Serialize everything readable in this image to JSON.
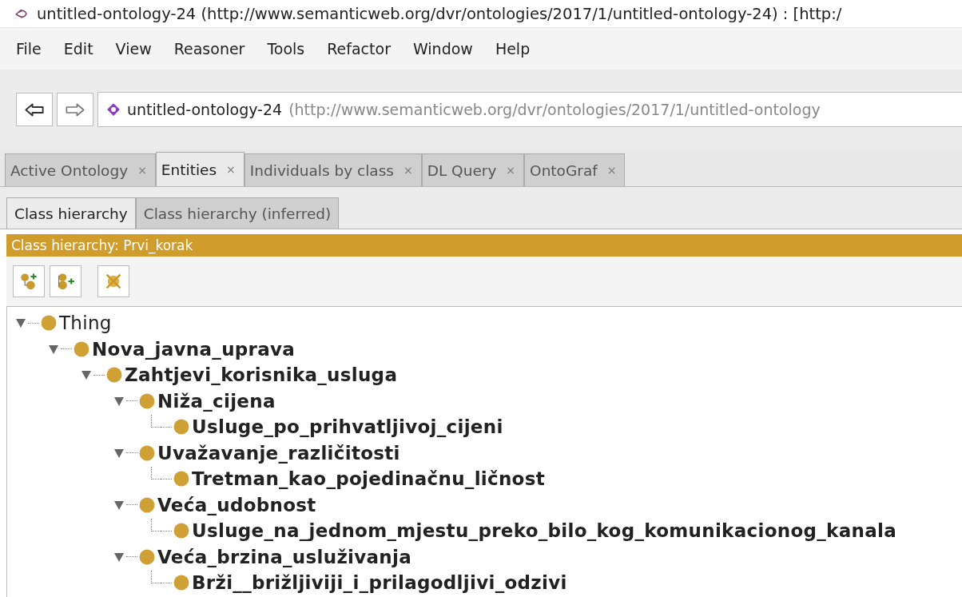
{
  "window": {
    "title": "untitled-ontology-24 (http://www.semanticweb.org/dvr/ontologies/2017/1/untitled-ontology-24) : [http:/"
  },
  "menu": [
    "File",
    "Edit",
    "View",
    "Reasoner",
    "Tools",
    "Refactor",
    "Window",
    "Help"
  ],
  "address": {
    "name": "untitled-ontology-24",
    "iri": "(http://www.semanticweb.org/dvr/ontologies/2017/1/untitled-ontology"
  },
  "tabs": [
    {
      "label": "Active Ontology",
      "close": "×",
      "selected": false
    },
    {
      "label": "Entities",
      "close": "×",
      "selected": true
    },
    {
      "label": "Individuals by class",
      "close": "×",
      "selected": false
    },
    {
      "label": "DL Query",
      "close": "×",
      "selected": false
    },
    {
      "label": "OntoGraf",
      "close": "×",
      "selected": false
    }
  ],
  "subtabs": [
    {
      "label": "Class hierarchy",
      "selected": true
    },
    {
      "label": "Class hierarchy (inferred)",
      "selected": false
    }
  ],
  "view_header": "Class hierarchy: Prvi_korak",
  "tree": [
    {
      "label": "Thing",
      "expanded": true,
      "children": [
        {
          "label": "Nova_javna_uprava",
          "expanded": true,
          "children": [
            {
              "label": "Zahtjevi_korisnika_usluga",
              "expanded": true,
              "children": [
                {
                  "label": "Niža_cijena",
                  "expanded": true,
                  "children": [
                    {
                      "label": "Usluge_po_prihvatljivoj_cijeni"
                    }
                  ]
                },
                {
                  "label": "Uvažavanje_različitosti",
                  "expanded": true,
                  "children": [
                    {
                      "label": "Tretman_kao_pojedinačnu_ličnost"
                    }
                  ]
                },
                {
                  "label": "Veća_udobnost",
                  "expanded": true,
                  "children": [
                    {
                      "label": "Usluge_na_jednom_mjestu_preko_bilo_kog_komunikacionog_kanala"
                    }
                  ]
                },
                {
                  "label": "Veća_brzina_usluživanja",
                  "expanded": true,
                  "children": [
                    {
                      "label": "Brži__brižljiviji_i_prilagodljivi_odzivi"
                    }
                  ]
                }
              ]
            }
          ]
        }
      ]
    }
  ]
}
